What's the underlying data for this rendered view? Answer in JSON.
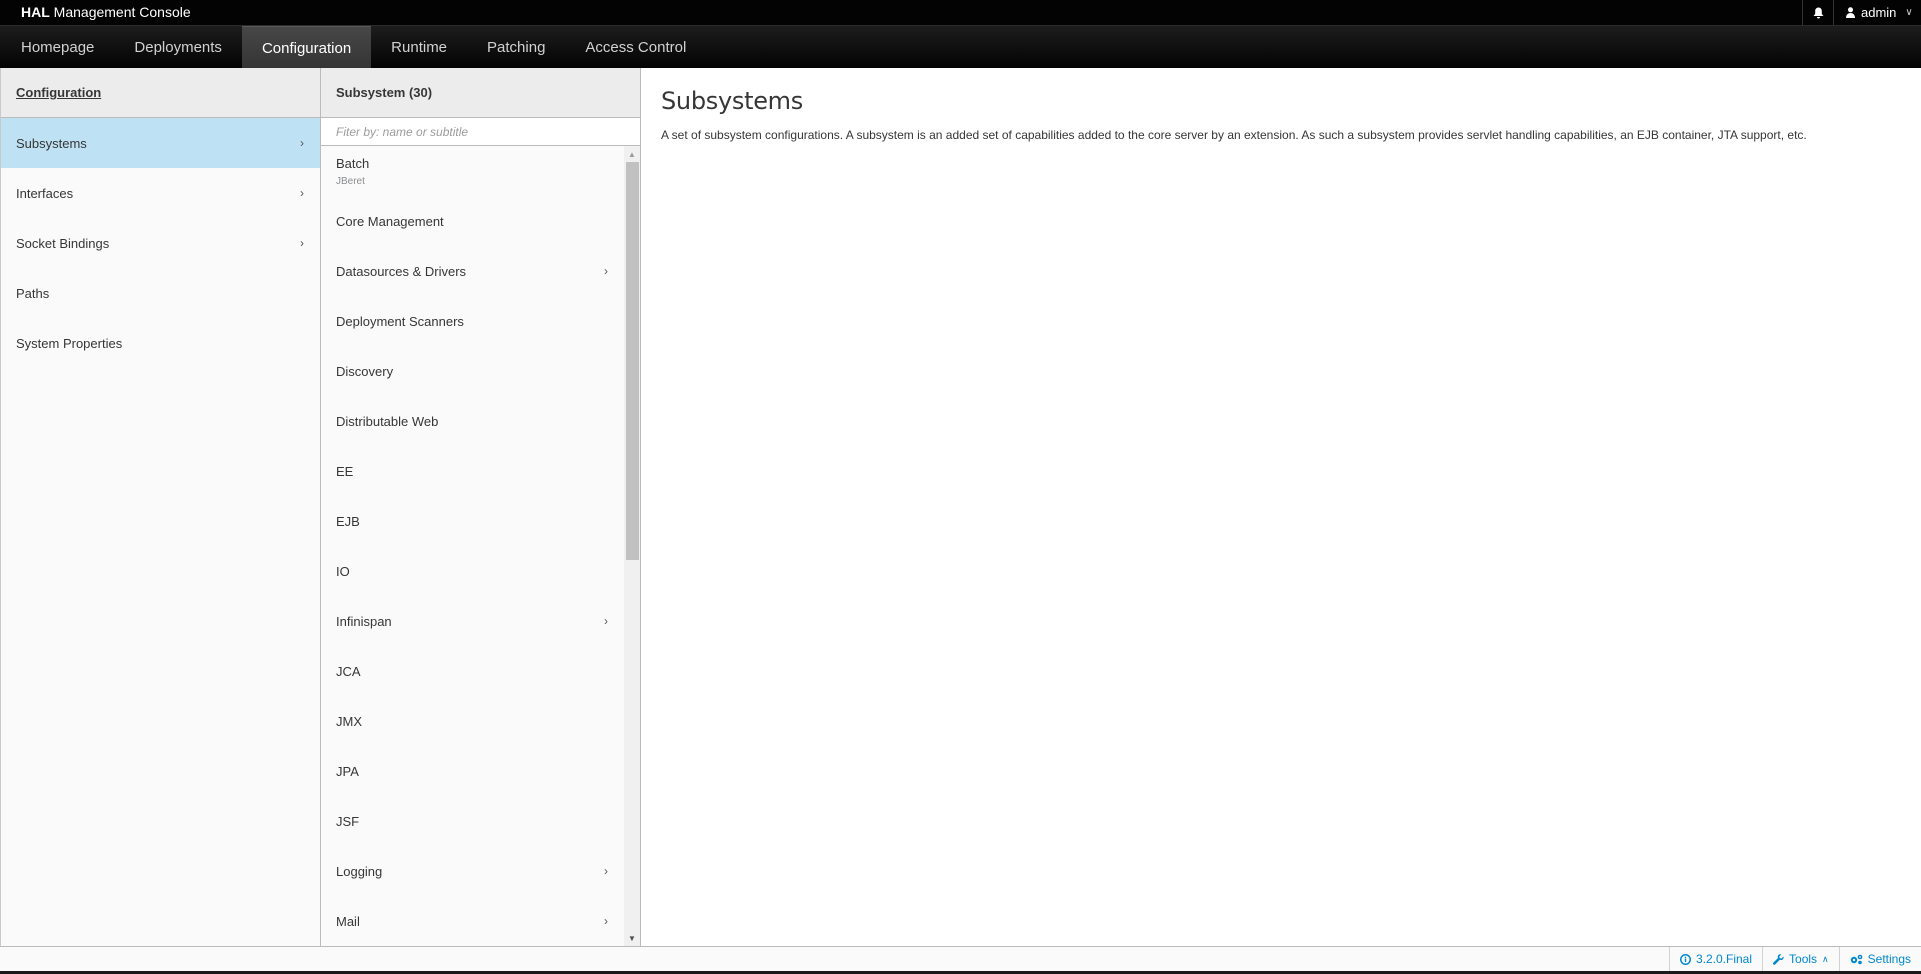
{
  "header": {
    "brand_bold": "HAL",
    "brand_rest": " Management Console",
    "notifications_icon": "bell-icon",
    "user": {
      "icon": "user-icon",
      "name": "admin"
    }
  },
  "nav": {
    "tabs": [
      {
        "label": "Homepage",
        "active": false
      },
      {
        "label": "Deployments",
        "active": false
      },
      {
        "label": "Configuration",
        "active": true
      },
      {
        "label": "Runtime",
        "active": false
      },
      {
        "label": "Patching",
        "active": false
      },
      {
        "label": "Access Control",
        "active": false
      }
    ]
  },
  "column1": {
    "title": "Configuration",
    "items": [
      {
        "label": "Subsystems",
        "has_next": true,
        "selected": true
      },
      {
        "label": "Interfaces",
        "has_next": true,
        "selected": false
      },
      {
        "label": "Socket Bindings",
        "has_next": true,
        "selected": false
      },
      {
        "label": "Paths",
        "has_next": false,
        "selected": false
      },
      {
        "label": "System Properties",
        "has_next": false,
        "selected": false
      }
    ]
  },
  "column2": {
    "title": "Subsystem (30)",
    "filter_placeholder": "Fiter by: name or subtitle",
    "filter_value": "",
    "items": [
      {
        "label": "Batch",
        "subtitle": "JBeret",
        "has_next": false
      },
      {
        "label": "Core Management",
        "has_next": false
      },
      {
        "label": "Datasources & Drivers",
        "has_next": true
      },
      {
        "label": "Deployment Scanners",
        "has_next": false
      },
      {
        "label": "Discovery",
        "has_next": false
      },
      {
        "label": "Distributable Web",
        "has_next": false
      },
      {
        "label": "EE",
        "has_next": false
      },
      {
        "label": "EJB",
        "has_next": false
      },
      {
        "label": "IO",
        "has_next": false
      },
      {
        "label": "Infinispan",
        "has_next": true
      },
      {
        "label": "JCA",
        "has_next": false
      },
      {
        "label": "JMX",
        "has_next": false
      },
      {
        "label": "JPA",
        "has_next": false
      },
      {
        "label": "JSF",
        "has_next": false
      },
      {
        "label": "Logging",
        "has_next": true
      },
      {
        "label": "Mail",
        "has_next": true
      }
    ]
  },
  "main": {
    "title": "Subsystems",
    "description": "A set of subsystem configurations. A subsystem is an added set of capabilities added to the core server by an extension. As such a subsystem provides servlet handling capabilities, an EJB container, JTA support, etc."
  },
  "footer": {
    "version": "3.2.0.Final",
    "tools_label": "Tools",
    "settings_label": "Settings"
  },
  "colors": {
    "selected_row": "#bee1f4",
    "link_blue": "#0088ce",
    "topbar": "#030303"
  }
}
